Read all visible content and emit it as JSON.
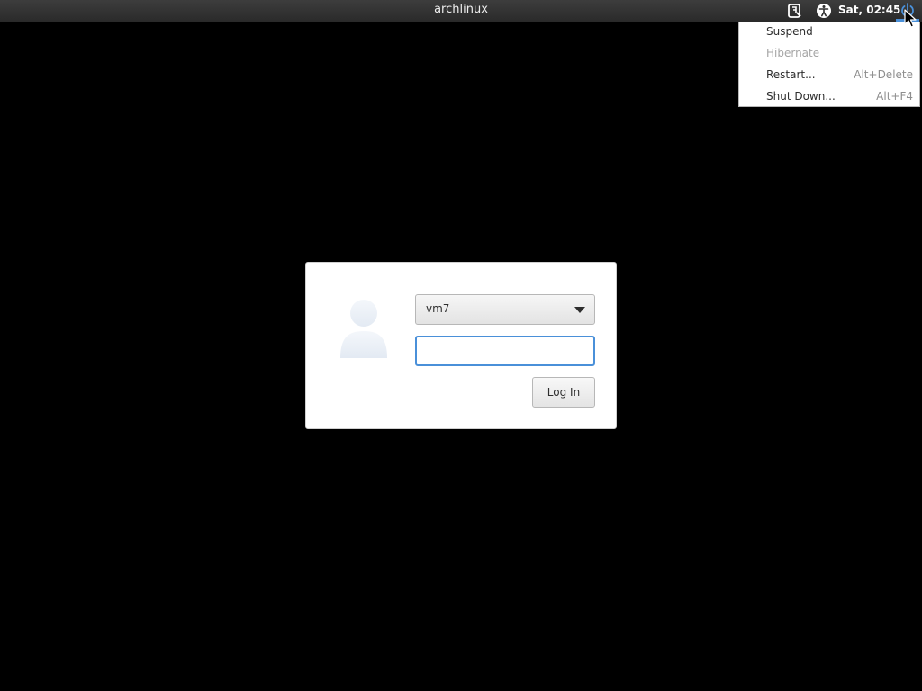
{
  "panel": {
    "hostname": "archlinux",
    "clock": "Sat, 02:45",
    "icons": {
      "keyboard": "keyboard-layout-icon",
      "accessibility": "accessibility-icon",
      "power": "power-icon"
    },
    "accent_color": "#4a90d9"
  },
  "power_menu": {
    "items": [
      {
        "label": "Suspend",
        "accel": "",
        "enabled": true
      },
      {
        "label": "Hibernate",
        "accel": "",
        "enabled": false
      },
      {
        "label": "Restart...",
        "accel": "Alt+Delete",
        "enabled": true
      },
      {
        "label": "Shut Down...",
        "accel": "Alt+F4",
        "enabled": true
      }
    ]
  },
  "login": {
    "selected_user": "vm7",
    "password_value": "",
    "password_placeholder": "",
    "login_button_label": "Log In",
    "avatar_icon": "user-avatar-icon"
  }
}
